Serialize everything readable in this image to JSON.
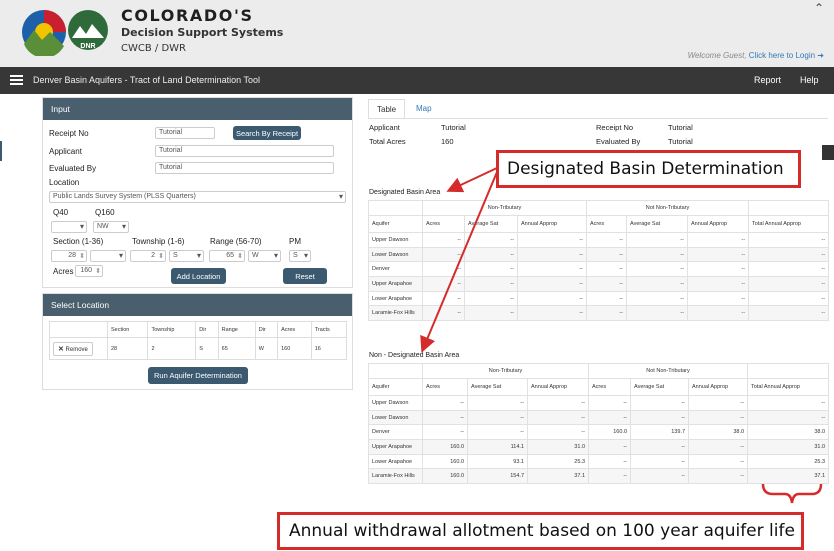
{
  "header": {
    "brand_title": "COLORADO'S",
    "brand_subtitle": "Decision Support Systems",
    "brand_agency": "CWCB / DWR",
    "logo_text": "DNR",
    "collapse_icon": "double-chevron-up",
    "welcome_text": "Welcome Guest,",
    "login_link": "Click here to Login",
    "login_icon": "login-icon"
  },
  "navbar": {
    "title": "Denver Basin Aquifers - Tract of Land Determination Tool",
    "report": "Report",
    "help": "Help"
  },
  "input_panel": {
    "title": "Input",
    "receipt_label": "Receipt No",
    "receipt_value": "Tutorial",
    "search_button": "Search By Receipt",
    "applicant_label": "Applicant",
    "applicant_value": "Tutorial",
    "evaluated_label": "Evaluated By",
    "evaluated_value": "Tutorial",
    "location_label": "Location",
    "location_value": "Public Lands Survey System (PLSS Quarters)",
    "q40_label": "Q40",
    "q160_label": "Q160",
    "q40_value": "",
    "q160_value": "NW",
    "section_label": "Section (1-36)",
    "section_value": "28",
    "township_label": "Township (1-6)",
    "township_value": "2",
    "township_dir": "S",
    "range_label": "Range (56-70)",
    "range_value": "65",
    "range_dir": "W",
    "pm_label": "PM",
    "pm_value": "S",
    "acres_label": "Acres",
    "acres_value": "160",
    "add_button": "Add Location",
    "reset_button": "Reset"
  },
  "select_panel": {
    "title": "Select Location",
    "headers": [
      "",
      "Section",
      "Township",
      "Dir",
      "Range",
      "Dir",
      "Acres",
      "Tracts"
    ],
    "row": {
      "remove": "Remove",
      "cells": [
        "28",
        "2",
        "S",
        "65",
        "W",
        "160",
        "16"
      ]
    },
    "run_button": "Run Aquifer Determination"
  },
  "tabs": {
    "table": "Table",
    "map": "Map"
  },
  "summary": {
    "applicant_label": "Applicant",
    "applicant_value": "Tutorial",
    "total_acres_label": "Total Acres",
    "total_acres_value": "160",
    "receipt_label": "Receipt No",
    "receipt_value": "Tutorial",
    "evaluated_label": "Evaluated By",
    "evaluated_value": "Tutorial"
  },
  "designated": {
    "title": "Designated Basin Area",
    "group_headers": [
      "Non-Tributary",
      "Not Non-Tributary"
    ],
    "headers": [
      "Aquifer",
      "Acres",
      "Average Sat",
      "Annual Approp",
      "Acres",
      "Average Sat",
      "Annual Approp",
      "Total Annual Approp"
    ],
    "rows": [
      [
        "Upper Dawson",
        "--",
        "--",
        "--",
        "--",
        "--",
        "--",
        "--"
      ],
      [
        "Lower Dawson",
        "--",
        "--",
        "--",
        "--",
        "--",
        "--",
        "--"
      ],
      [
        "Denver",
        "--",
        "--",
        "--",
        "--",
        "--",
        "--",
        "--"
      ],
      [
        "Upper Arapahoe",
        "--",
        "--",
        "--",
        "--",
        "--",
        "--",
        "--"
      ],
      [
        "Lower Arapahoe",
        "--",
        "--",
        "--",
        "--",
        "--",
        "--",
        "--"
      ],
      [
        "Laramie-Fox Hills",
        "--",
        "--",
        "--",
        "--",
        "--",
        "--",
        "--"
      ]
    ]
  },
  "non_designated": {
    "title": "Non - Designated Basin Area",
    "group_headers": [
      "Non-Tributary",
      "Not Non-Tributary"
    ],
    "headers": [
      "Aquifer",
      "Acres",
      "Average Sat",
      "Annual Approp",
      "Acres",
      "Average Sat",
      "Annual Approp",
      "Total Annual Approp"
    ],
    "rows": [
      [
        "Upper Dawson",
        "--",
        "--",
        "--",
        "--",
        "--",
        "--",
        "--"
      ],
      [
        "Lower Dawson",
        "--",
        "--",
        "--",
        "--",
        "--",
        "--",
        "--"
      ],
      [
        "Denver",
        "--",
        "--",
        "--",
        "160.0",
        "139.7",
        "38.0",
        "38.0"
      ],
      [
        "Upper Arapahoe",
        "160.0",
        "114.1",
        "31.0",
        "--",
        "--",
        "--",
        "31.0"
      ],
      [
        "Lower Arapahoe",
        "160.0",
        "93.1",
        "25.3",
        "--",
        "--",
        "--",
        "25.3"
      ],
      [
        "Laramie-Fox Hills",
        "160.0",
        "154.7",
        "37.1",
        "--",
        "--",
        "--",
        "37.1"
      ]
    ]
  },
  "annotations": {
    "designated_callout": "Designated Basin Determination",
    "allotment_callout": "Annual withdrawal allotment based on 100 year aquifer life",
    "callout_color": "#d62b2b"
  },
  "colors": {
    "navbar": "#373737",
    "panel_header": "#4a5f6e",
    "button": "#3b5a70",
    "link": "#337ab7"
  }
}
